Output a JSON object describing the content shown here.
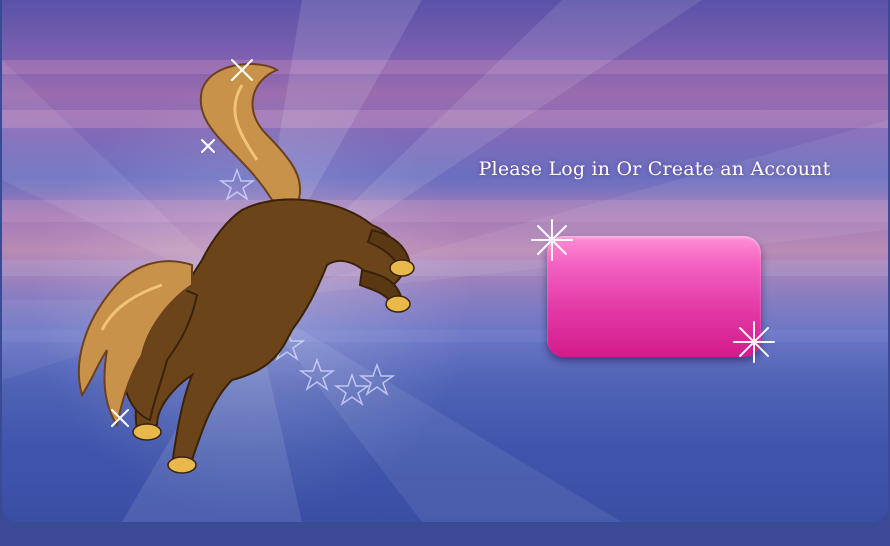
{
  "login": {
    "prompt": "Please Log in Or Create an Account",
    "button_label": ""
  },
  "colors": {
    "button_top": "#ff8fd6",
    "button_bottom": "#d41b8c",
    "sky_purple": "#9a6cae",
    "sky_blue": "#3f55ac"
  },
  "artwork": {
    "subject": "horse-icon"
  }
}
